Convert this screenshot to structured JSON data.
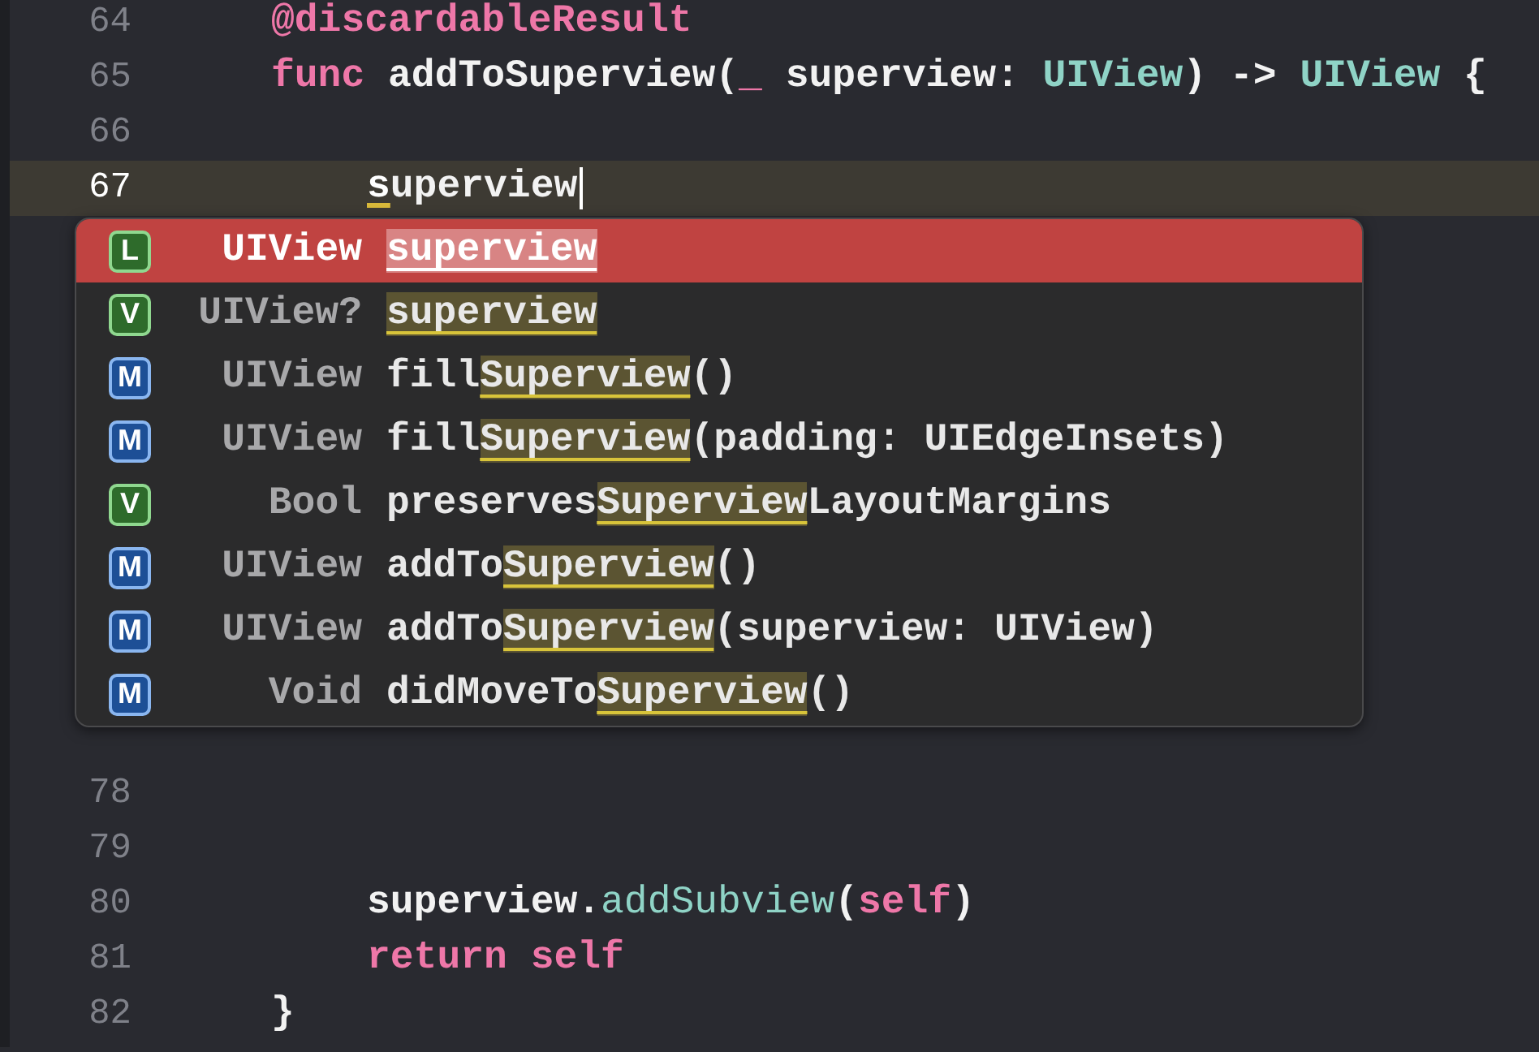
{
  "editor": {
    "lines": [
      {
        "number": "64",
        "current": false,
        "kind": "member",
        "tokens": [
          {
            "text": "@discardableResult",
            "kind": "keyword"
          }
        ]
      },
      {
        "number": "65",
        "current": false,
        "kind": "member",
        "tokens": [
          {
            "text": "func",
            "kind": "keyword"
          },
          {
            "text": " addToSuperview(",
            "kind": "plain"
          },
          {
            "text": "_",
            "kind": "keyword"
          },
          {
            "text": " superview: ",
            "kind": "plain"
          },
          {
            "text": "UIView",
            "kind": "type"
          },
          {
            "text": ") -> ",
            "kind": "plain"
          },
          {
            "text": "UIView",
            "kind": "type"
          },
          {
            "text": " {",
            "kind": "plain"
          }
        ]
      },
      {
        "number": "66",
        "current": false
      },
      {
        "number": "67",
        "current": true,
        "cursor": true,
        "kind": "statement",
        "tokens": [
          {
            "text": "s",
            "kind": "marked"
          },
          {
            "text": "uperview",
            "kind": "plain"
          }
        ]
      },
      {
        "number": "78",
        "current": false
      },
      {
        "number": "79",
        "current": false
      },
      {
        "number": "80",
        "current": false,
        "kind": "statement",
        "tokens": [
          {
            "text": "superview.",
            "kind": "plain"
          },
          {
            "text": "addSubview",
            "kind": "call"
          },
          {
            "text": "(",
            "kind": "plain"
          },
          {
            "text": "self",
            "kind": "keyword"
          },
          {
            "text": ")",
            "kind": "plain"
          }
        ]
      },
      {
        "number": "81",
        "current": false,
        "kind": "statement",
        "tokens": [
          {
            "text": "return self",
            "kind": "keyword"
          }
        ]
      },
      {
        "number": "82",
        "current": false,
        "kind": "member",
        "tokens": [
          {
            "text": "}",
            "kind": "plain"
          }
        ]
      }
    ]
  },
  "completions": [
    {
      "badge": "L",
      "kind": "local",
      "type": "UIView",
      "selected": true,
      "name": [
        {
          "text": "superview",
          "match": true
        }
      ]
    },
    {
      "badge": "V",
      "kind": "variable",
      "type": "UIView?",
      "selected": false,
      "name": [
        {
          "text": "superview",
          "match": true
        }
      ]
    },
    {
      "badge": "M",
      "kind": "method",
      "type": "UIView",
      "selected": false,
      "name": [
        {
          "text": "fill",
          "match": false
        },
        {
          "text": "Superview",
          "match": true
        },
        {
          "text": "()",
          "match": false
        }
      ]
    },
    {
      "badge": "M",
      "kind": "method",
      "type": "UIView",
      "selected": false,
      "name": [
        {
          "text": "fill",
          "match": false
        },
        {
          "text": "Superview",
          "match": true
        },
        {
          "text": "(padding: UIEdgeInsets)",
          "match": false
        }
      ]
    },
    {
      "badge": "V",
      "kind": "variable",
      "type": "Bool",
      "selected": false,
      "name": [
        {
          "text": "preserves",
          "match": false
        },
        {
          "text": "Superview",
          "match": true
        },
        {
          "text": "LayoutMargins",
          "match": false
        }
      ]
    },
    {
      "badge": "M",
      "kind": "method",
      "type": "UIView",
      "selected": false,
      "name": [
        {
          "text": "addTo",
          "match": false
        },
        {
          "text": "Superview",
          "match": true
        },
        {
          "text": "()",
          "match": false
        }
      ]
    },
    {
      "badge": "M",
      "kind": "method",
      "type": "UIView",
      "selected": false,
      "name": [
        {
          "text": "addTo",
          "match": false
        },
        {
          "text": "Superview",
          "match": true
        },
        {
          "text": "(superview: UIView)",
          "match": false
        }
      ]
    },
    {
      "badge": "M",
      "kind": "method",
      "type": "Void",
      "selected": false,
      "name": [
        {
          "text": "didMoveTo",
          "match": false
        },
        {
          "text": "Superview",
          "match": true
        },
        {
          "text": "()",
          "match": false
        }
      ]
    }
  ]
}
